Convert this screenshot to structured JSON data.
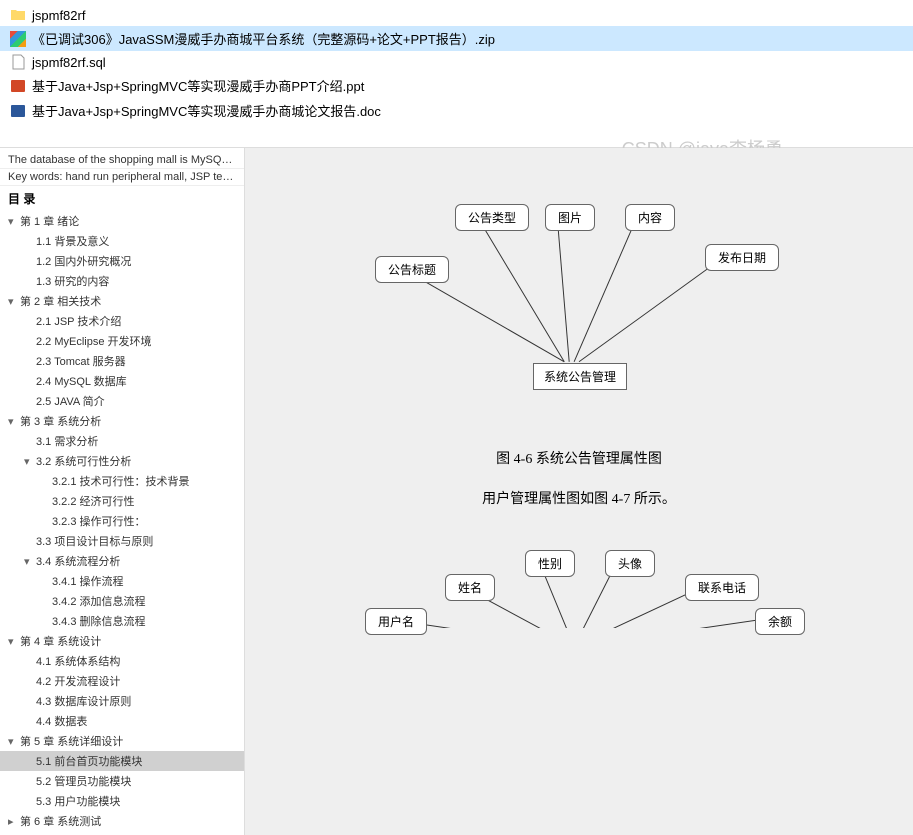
{
  "files": [
    {
      "name": "jspmf82rf",
      "icon": "folder"
    },
    {
      "name": "《已调试306》JavaSSM漫威手办商城平台系统（完整源码+论文+PPT报告）.zip",
      "icon": "zip",
      "selected": true
    },
    {
      "name": "jspmf82rf.sql",
      "icon": "sql"
    },
    {
      "name": "基于Java+Jsp+SpringMVC等实现漫威手办商PPT介绍.ppt",
      "icon": "ppt"
    },
    {
      "name": "基于Java+Jsp+SpringMVC等实现漫威手办商城论文报告.doc",
      "icon": "doc"
    }
  ],
  "watermark": "CSDN @java李杨勇",
  "outline": {
    "header1": "The database of the shopping mall is MySQL, which h...",
    "header2": "Key words: hand run peripheral mall, JSP technolog ...",
    "title": "目 录",
    "items": [
      {
        "text": "第 1 章  绪论",
        "level": 1,
        "expanded": true
      },
      {
        "text": "1.1 背景及意义",
        "level": 2
      },
      {
        "text": "1.2 国内外研究概况",
        "level": 2
      },
      {
        "text": "1.3 研究的内容",
        "level": 2
      },
      {
        "text": "第 2 章  相关技术",
        "level": 1,
        "expanded": true
      },
      {
        "text": "2.1 JSP 技术介绍",
        "level": 2
      },
      {
        "text": "2.2 MyEclipse 开发环境",
        "level": 2
      },
      {
        "text": "2.3 Tomcat 服务器",
        "level": 2
      },
      {
        "text": "2.4 MySQL 数据库",
        "level": 2
      },
      {
        "text": "2.5 JAVA 简介",
        "level": 2
      },
      {
        "text": "第 3 章  系统分析",
        "level": 1,
        "expanded": true
      },
      {
        "text": "3.1 需求分析",
        "level": 2
      },
      {
        "text": "3.2 系统可行性分析",
        "level": 2,
        "expanded": true
      },
      {
        "text": "3.2.1 技术可行性：技术背景",
        "level": 3
      },
      {
        "text": "3.2.2 经济可行性",
        "level": 3
      },
      {
        "text": "3.2.3 操作可行性：",
        "level": 3
      },
      {
        "text": "3.3 项目设计目标与原则",
        "level": 2
      },
      {
        "text": "3.4 系统流程分析",
        "level": 2,
        "expanded": true
      },
      {
        "text": "3.4.1 操作流程",
        "level": 3
      },
      {
        "text": "3.4.2 添加信息流程",
        "level": 3
      },
      {
        "text": "3.4.3 删除信息流程",
        "level": 3
      },
      {
        "text": "第 4 章  系统设计",
        "level": 1,
        "expanded": true
      },
      {
        "text": "4.1 系统体系结构",
        "level": 2
      },
      {
        "text": "4.2 开发流程设计",
        "level": 2
      },
      {
        "text": "4.3 数据库设计原则",
        "level": 2
      },
      {
        "text": "4.4 数据表",
        "level": 2
      },
      {
        "text": "第 5 章  系统详细设计",
        "level": 1,
        "expanded": true
      },
      {
        "text": "5.1 前台首页功能模块",
        "level": 2,
        "selected": true
      },
      {
        "text": "5.2 管理员功能模块",
        "level": 2
      },
      {
        "text": "5.3 用户功能模块",
        "level": 2
      },
      {
        "text": "第 6 章  系统测试",
        "level": 1
      }
    ]
  },
  "diagram1": {
    "center": "系统公告管理",
    "nodes": [
      {
        "label": "公告标题"
      },
      {
        "label": "公告类型"
      },
      {
        "label": "图片"
      },
      {
        "label": "内容"
      },
      {
        "label": "发布日期"
      }
    ]
  },
  "figure_caption": "图 4-6 系统公告管理属性图",
  "figure_text": "用户管理属性图如图 4-7 所示。",
  "diagram2": {
    "nodes": [
      {
        "label": "用户名"
      },
      {
        "label": "姓名"
      },
      {
        "label": "性别"
      },
      {
        "label": "头像"
      },
      {
        "label": "联系电话"
      },
      {
        "label": "余额"
      }
    ]
  }
}
